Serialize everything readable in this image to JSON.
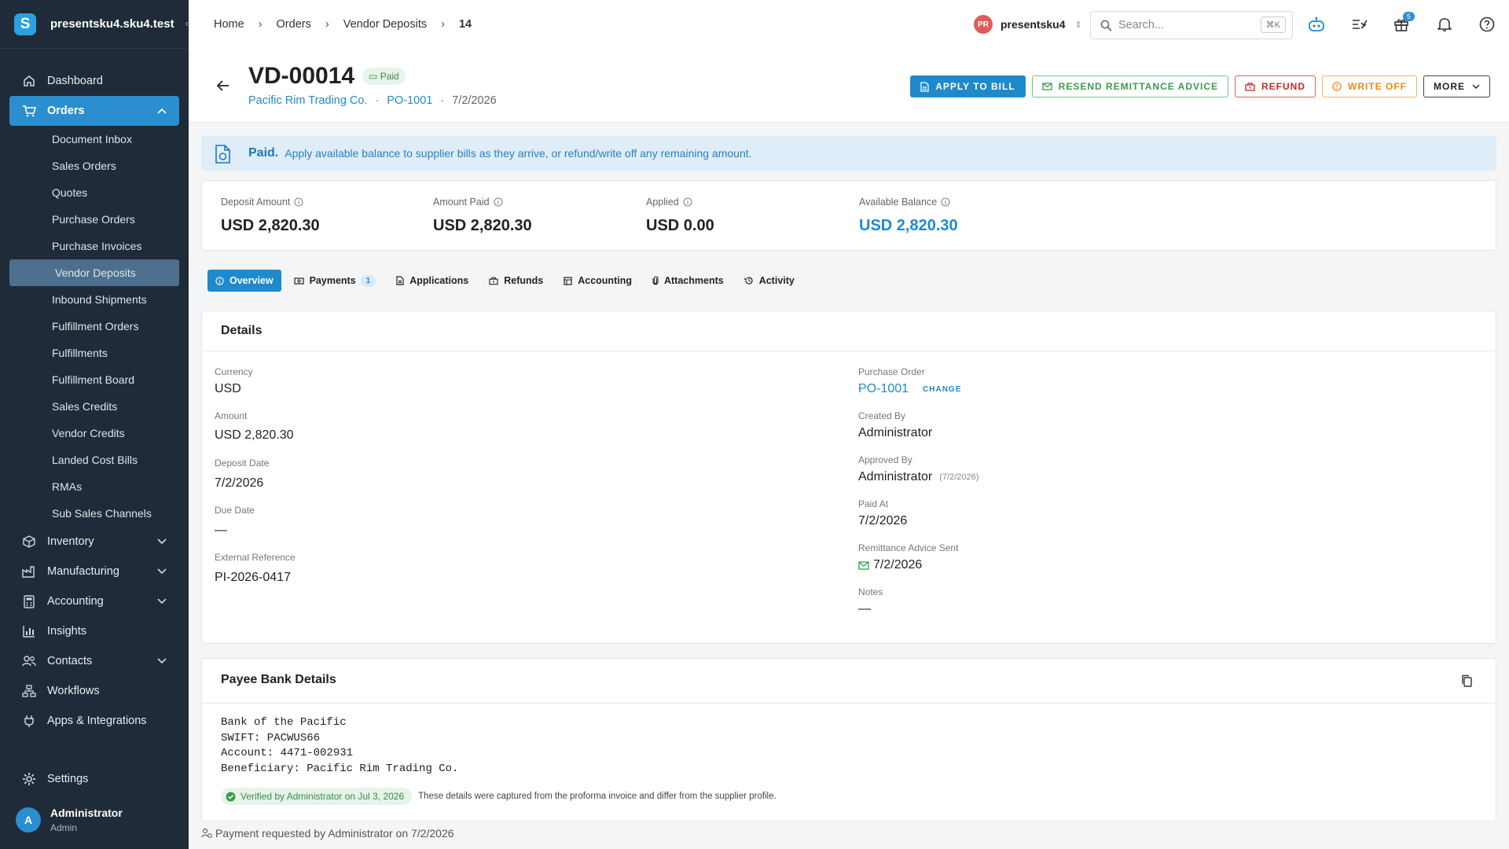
{
  "app": {
    "name": "presentsku4.sku4.test",
    "logo": "S"
  },
  "sidebar": {
    "items": [
      {
        "label": "Dashboard"
      },
      {
        "label": "Orders"
      },
      {
        "label": "Inventory"
      },
      {
        "label": "Manufacturing"
      },
      {
        "label": "Accounting"
      },
      {
        "label": "Insights"
      },
      {
        "label": "Contacts"
      },
      {
        "label": "Workflows"
      },
      {
        "label": "Apps & Integrations"
      }
    ],
    "orders_sub": [
      "Document Inbox",
      "Sales Orders",
      "Quotes",
      "Purchase Orders",
      "Purchase Invoices",
      "Vendor Deposits",
      "Inbound Shipments",
      "Fulfillment Orders",
      "Fulfillments",
      "Fulfillment Board",
      "Sales Credits",
      "Vendor Credits",
      "Landed Cost Bills",
      "RMAs",
      "Sub Sales Channels"
    ],
    "settings": "Settings",
    "user": {
      "initial": "A",
      "name": "Administrator",
      "role": "Admin"
    }
  },
  "topbar": {
    "breadcrumb": [
      "Home",
      "Orders",
      "Vendor Deposits",
      "14"
    ],
    "tenant": {
      "initials": "PR",
      "name": "presentsku4"
    },
    "search": {
      "placeholder": "Search...",
      "shortcut": "⌘K"
    },
    "gift_badge": "5"
  },
  "header": {
    "title": "VD-00014",
    "status": "Paid",
    "supplier": "Pacific Rim Trading Co.",
    "po": "PO-1001",
    "date": "7/2/2026",
    "actions": {
      "apply": "APPLY TO BILL",
      "resend": "RESEND REMITTANCE ADVICE",
      "refund": "REFUND",
      "writeoff": "WRITE OFF",
      "more": "MORE"
    }
  },
  "banner": {
    "title": "Paid.",
    "text": "Apply available balance to supplier bills as they arrive, or refund/write off any remaining amount."
  },
  "metrics": [
    {
      "label": "Deposit Amount",
      "value": "USD 2,820.30"
    },
    {
      "label": "Amount Paid",
      "value": "USD 2,820.30"
    },
    {
      "label": "Applied",
      "value": "USD 0.00"
    },
    {
      "label": "Available Balance",
      "value": "USD 2,820.30"
    }
  ],
  "tabs": [
    {
      "label": "Overview"
    },
    {
      "label": "Payments",
      "count": "1"
    },
    {
      "label": "Applications"
    },
    {
      "label": "Refunds"
    },
    {
      "label": "Accounting"
    },
    {
      "label": "Attachments"
    },
    {
      "label": "Activity"
    }
  ],
  "details": {
    "title": "Details",
    "left": [
      {
        "label": "Currency",
        "value": "USD"
      },
      {
        "label": "Amount",
        "value": "USD 2,820.30"
      },
      {
        "label": "Deposit Date",
        "value": "7/2/2026"
      },
      {
        "label": "Due Date",
        "value": "—"
      },
      {
        "label": "External Reference",
        "value": "PI-2026-0417"
      }
    ],
    "right": {
      "po_label": "Purchase Order",
      "po_value": "PO-1001",
      "po_change": "CHANGE",
      "created_label": "Created By",
      "created_value": "Administrator",
      "approved_label": "Approved By",
      "approved_value": "Administrator",
      "approved_date": "(7/2/2026)",
      "paid_label": "Paid At",
      "paid_value": "7/2/2026",
      "remit_label": "Remittance Advice Sent",
      "remit_value": "7/2/2026",
      "notes_label": "Notes",
      "notes_value": "—"
    }
  },
  "bank": {
    "title": "Payee Bank Details",
    "text": "Bank of the Pacific\nSWIFT: PACWUS66\nAccount: 4471-002931\nBeneficiary: Pacific Rim Trading Co.",
    "verified": "Verified by Administrator on Jul 3, 2026",
    "note": "These details were captured from the proforma invoice and differ from the supplier profile."
  },
  "footer_note": "Payment requested by Administrator on 7/2/2026",
  "colors": {
    "accent": "#1f8acb",
    "sidebar": "#1f2b38",
    "success": "#3b8a4c",
    "danger": "#c62828",
    "warning": "#ef8a14"
  }
}
